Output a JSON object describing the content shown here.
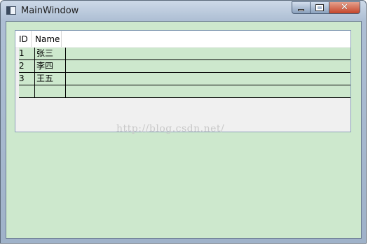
{
  "window": {
    "title": "MainWindow",
    "minimize_label": "",
    "maximize_label": "",
    "close_label": "✕"
  },
  "grid": {
    "columns": [
      "ID",
      "Name"
    ],
    "rows": [
      {
        "id": "1",
        "name": "张三"
      },
      {
        "id": "2",
        "name": "李四"
      },
      {
        "id": "3",
        "name": "王五"
      },
      {
        "id": "",
        "name": ""
      }
    ]
  },
  "watermark": "http://blog.csdn.net/",
  "colors": {
    "client_background": "#cde8cd",
    "grid_background": "#f0f0f0",
    "close_button": "#c5452a"
  }
}
